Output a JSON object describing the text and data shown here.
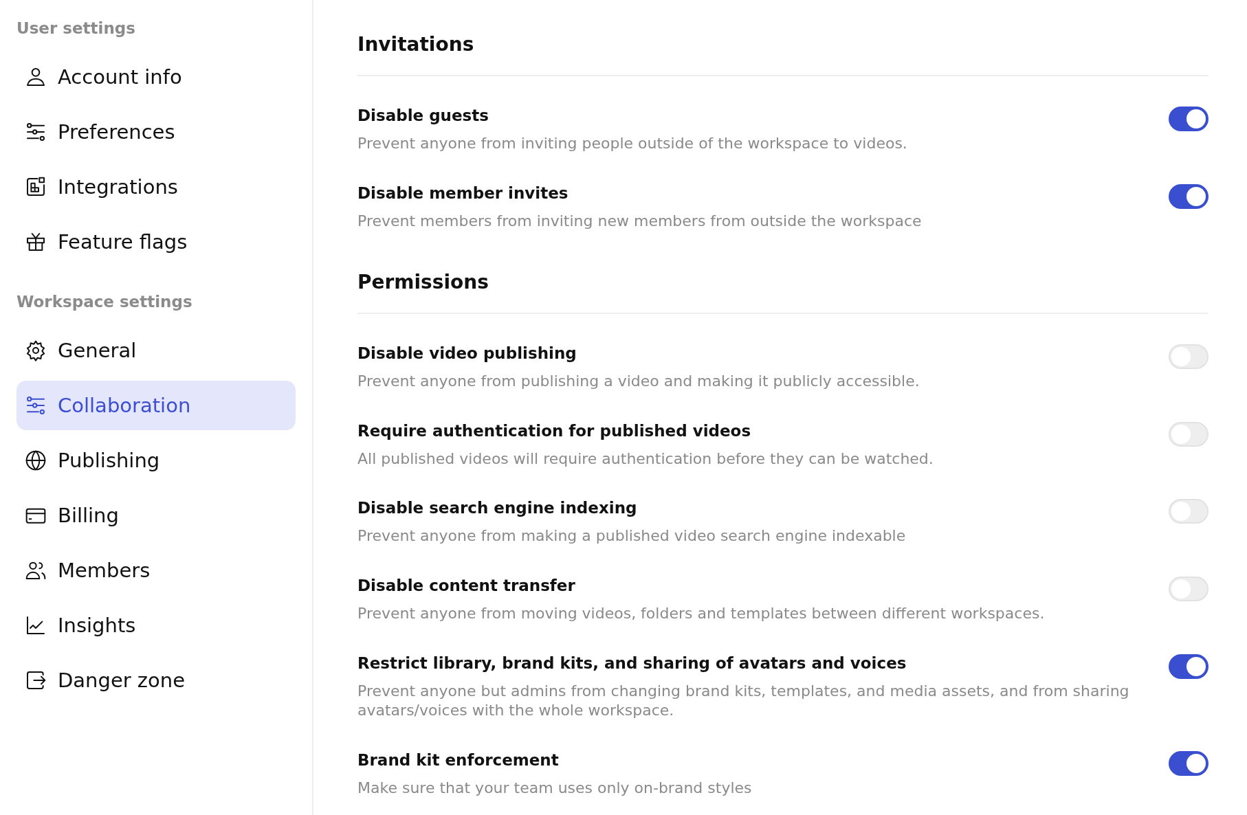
{
  "sidebar": {
    "groups": [
      {
        "label": "User settings",
        "items": [
          {
            "label": "Account info",
            "kind": "person",
            "selected": false
          },
          {
            "label": "Preferences",
            "kind": "sliders",
            "selected": false
          },
          {
            "label": "Integrations",
            "kind": "blocks",
            "selected": false
          },
          {
            "label": "Feature flags",
            "kind": "gift",
            "selected": false
          }
        ]
      },
      {
        "label": "Workspace settings",
        "items": [
          {
            "label": "General",
            "kind": "gear",
            "selected": false
          },
          {
            "label": "Collaboration",
            "kind": "sliders",
            "selected": true
          },
          {
            "label": "Publishing",
            "kind": "globe",
            "selected": false
          },
          {
            "label": "Billing",
            "kind": "card",
            "selected": false
          },
          {
            "label": "Members",
            "kind": "people",
            "selected": false
          },
          {
            "label": "Insights",
            "kind": "chart",
            "selected": false
          },
          {
            "label": "Danger zone",
            "kind": "exit",
            "selected": false
          }
        ]
      }
    ]
  },
  "sections": [
    {
      "title": "Invitations",
      "settings": [
        {
          "title": "Disable guests",
          "description": "Prevent anyone from inviting people outside of the workspace to videos.",
          "on": true
        },
        {
          "title": "Disable member invites",
          "description": "Prevent members from inviting new members from outside the workspace",
          "on": true
        }
      ]
    },
    {
      "title": "Permissions",
      "settings": [
        {
          "title": "Disable video publishing",
          "description": "Prevent anyone from publishing a video and making it publicly accessible.",
          "on": false
        },
        {
          "title": "Require authentication for published videos",
          "description": "All published videos will require authentication before they can be watched.",
          "on": false
        },
        {
          "title": "Disable search engine indexing",
          "description": "Prevent anyone from making a published video search engine indexable",
          "on": false
        },
        {
          "title": "Disable content transfer",
          "description": "Prevent anyone from moving videos, folders and templates between different workspaces.",
          "on": false
        },
        {
          "title": "Restrict library, brand kits, and sharing of avatars and voices",
          "description": "Prevent anyone but admins from changing brand kits, templates, and media assets, and from sharing avatars/voices with the whole workspace.",
          "on": true
        },
        {
          "title": "Brand kit enforcement",
          "description": "Make sure that your team uses only on-brand styles",
          "on": true
        }
      ]
    }
  ]
}
